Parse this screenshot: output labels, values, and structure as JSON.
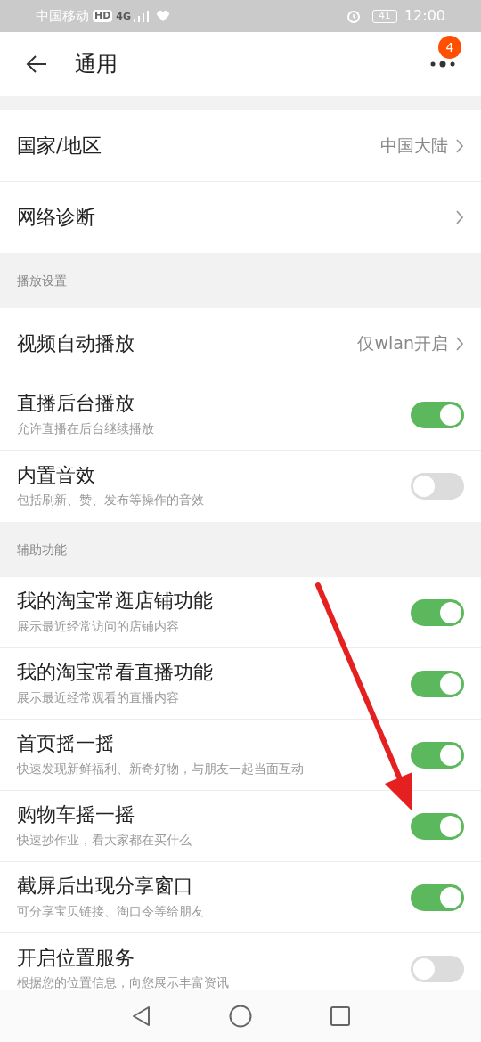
{
  "status_bar": {
    "carrier": "中国移动",
    "hd": "HD",
    "network": "4G",
    "battery": "41",
    "time": "12:00"
  },
  "header": {
    "title": "通用",
    "badge": "4"
  },
  "sections": [
    {
      "items": [
        {
          "kind": "link",
          "title": "国家/地区",
          "value": "中国大陆"
        },
        {
          "kind": "link",
          "title": "网络诊断"
        }
      ]
    },
    {
      "header": "播放设置",
      "items": [
        {
          "kind": "link",
          "title": "视频自动播放",
          "value": "仅wlan开启"
        },
        {
          "kind": "toggle",
          "title": "直播后台播放",
          "subtitle": "允许直播在后台继续播放",
          "on": true
        },
        {
          "kind": "toggle",
          "title": "内置音效",
          "subtitle": "包括刷新、赞、发布等操作的音效",
          "on": false
        }
      ]
    },
    {
      "header": "辅助功能",
      "items": [
        {
          "kind": "toggle",
          "title": "我的淘宝常逛店铺功能",
          "subtitle": "展示最近经常访问的店铺内容",
          "on": true
        },
        {
          "kind": "toggle",
          "title": "我的淘宝常看直播功能",
          "subtitle": "展示最近经常观看的直播内容",
          "on": true
        },
        {
          "kind": "toggle",
          "title": "首页摇一摇",
          "subtitle": "快速发现新鲜福利、新奇好物，与朋友一起当面互动",
          "on": true
        },
        {
          "kind": "toggle",
          "title": "购物车摇一摇",
          "subtitle": "快速抄作业，看大家都在买什么",
          "on": true
        },
        {
          "kind": "toggle",
          "title": "截屏后出现分享窗口",
          "subtitle": "可分享宝贝链接、淘口令等给朋友",
          "on": true
        },
        {
          "kind": "toggle",
          "title": "开启位置服务",
          "subtitle": "根据您的位置信息，向您展示丰富资讯",
          "on": false
        }
      ]
    }
  ]
}
